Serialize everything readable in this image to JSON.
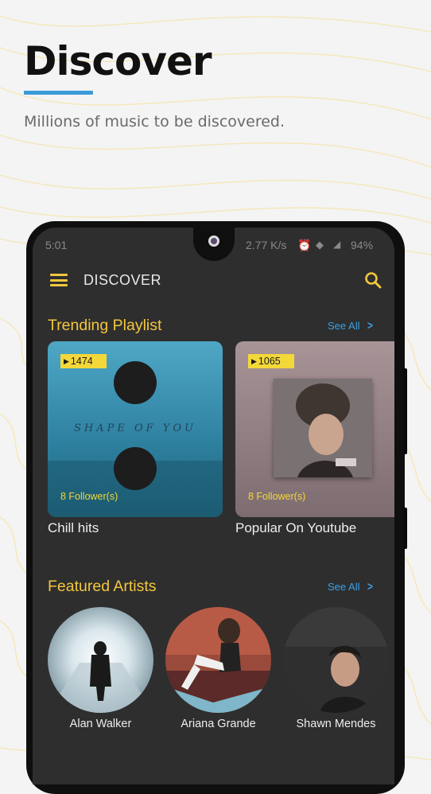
{
  "header": {
    "title": "Discover",
    "subtitle": "Millions of music to be discovered."
  },
  "status_bar": {
    "time": "5:01",
    "speed": "2.77 K/s",
    "battery": "94%"
  },
  "app_bar": {
    "title": "DISCOVER"
  },
  "trending": {
    "title": "Trending Playlist",
    "see_all": "See All",
    "playlists": [
      {
        "name": "Chill hits",
        "plays": "1474",
        "followers": "8 Follower(s)",
        "cover_text": "SHAPE OF YOU"
      },
      {
        "name": "Popular On Youtube",
        "plays": "1065",
        "followers": "8 Follower(s)"
      }
    ]
  },
  "featured": {
    "title": "Featured Artists",
    "see_all": "See All",
    "artists": [
      {
        "name": "Alan Walker"
      },
      {
        "name": "Ariana Grande"
      },
      {
        "name": "Shawn Mendes"
      }
    ]
  },
  "colors": {
    "accent_yellow": "#f3c63e",
    "link_blue": "#3aa0e6",
    "screen_bg": "#2e2e2e",
    "underline_blue": "#3a9bd8"
  }
}
